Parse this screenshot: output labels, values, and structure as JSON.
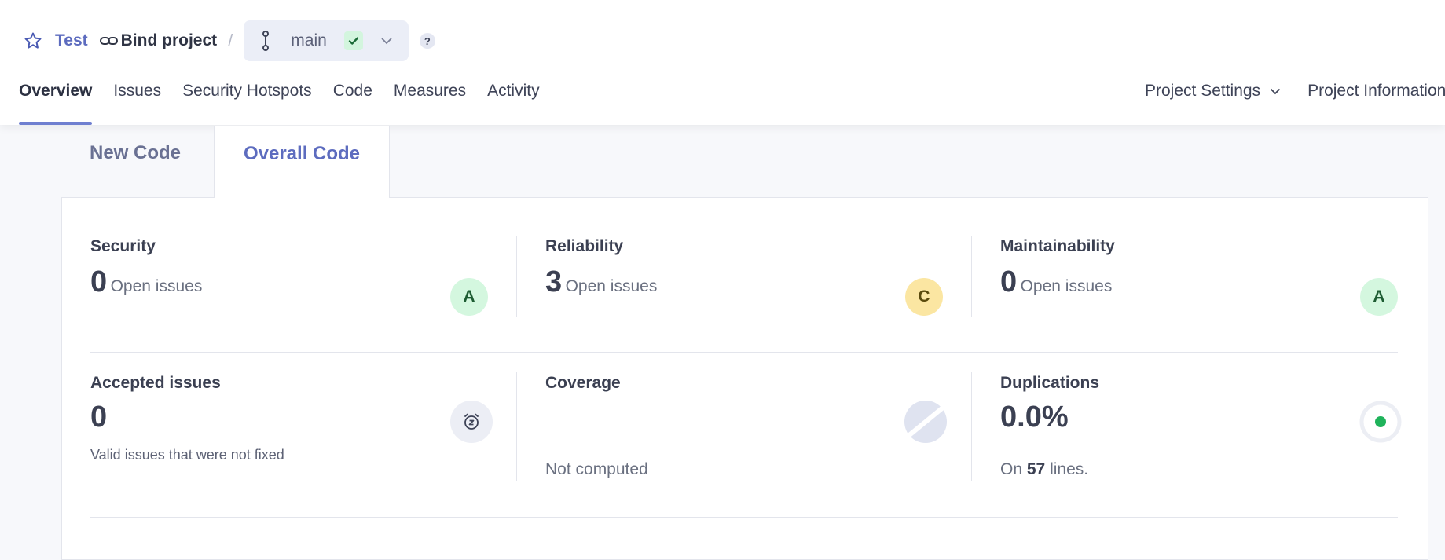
{
  "breadcrumb": {
    "project": "Test",
    "bind": "Bind project",
    "separator": "/",
    "branch": "main",
    "help": "?"
  },
  "nav": {
    "items": [
      "Overview",
      "Issues",
      "Security Hotspots",
      "Code",
      "Measures",
      "Activity"
    ],
    "active": "Overview",
    "project_settings": "Project Settings",
    "project_information": "Project Information"
  },
  "tabs": {
    "new_code": "New Code",
    "overall_code": "Overall Code",
    "selected": "Overall Code"
  },
  "cards": {
    "security": {
      "title": "Security",
      "value": "0",
      "label": "Open issues",
      "grade": "A"
    },
    "reliability": {
      "title": "Reliability",
      "value": "3",
      "label": "Open issues",
      "grade": "C"
    },
    "maintainability": {
      "title": "Maintainability",
      "value": "0",
      "label": "Open issues",
      "grade": "A"
    },
    "accepted": {
      "title": "Accepted issues",
      "value": "0",
      "description": "Valid issues that were not fixed"
    },
    "coverage": {
      "title": "Coverage",
      "status": "Not computed"
    },
    "duplications": {
      "title": "Duplications",
      "value": "0.0%",
      "prefix": "On",
      "lines": "57",
      "suffix": "lines."
    }
  },
  "colors": {
    "accent": "#5d6cbf",
    "grade_a_bg": "#d4f7df",
    "grade_c_bg": "#fbe6a2",
    "duplication_dot": "#1fb35b"
  }
}
